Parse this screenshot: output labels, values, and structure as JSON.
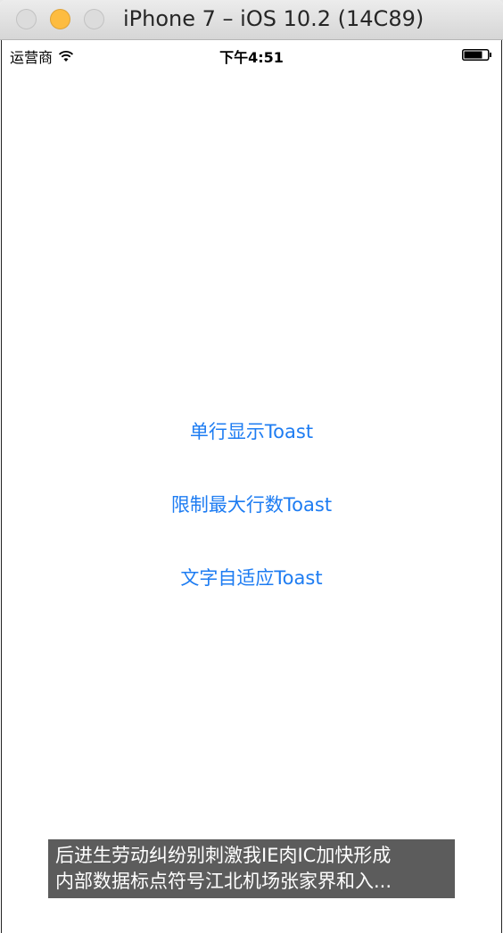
{
  "window": {
    "title": "iPhone 7 – iOS 10.2 (14C89)"
  },
  "status_bar": {
    "carrier": "运营商",
    "time": "下午4:51"
  },
  "buttons": [
    {
      "label": "单行显示Toast"
    },
    {
      "label": "限制最大行数Toast"
    },
    {
      "label": "文字自适应Toast"
    }
  ],
  "toast": {
    "line1": "后进生劳动纠纷别刺激我IE肉IC加快形成",
    "line2": "内部数据标点符号江北机场张家界和入..."
  },
  "colors": {
    "accent": "#1d7cf2",
    "toast_bg": "#5c5c5c",
    "minimize_button": "#fdbc40"
  }
}
